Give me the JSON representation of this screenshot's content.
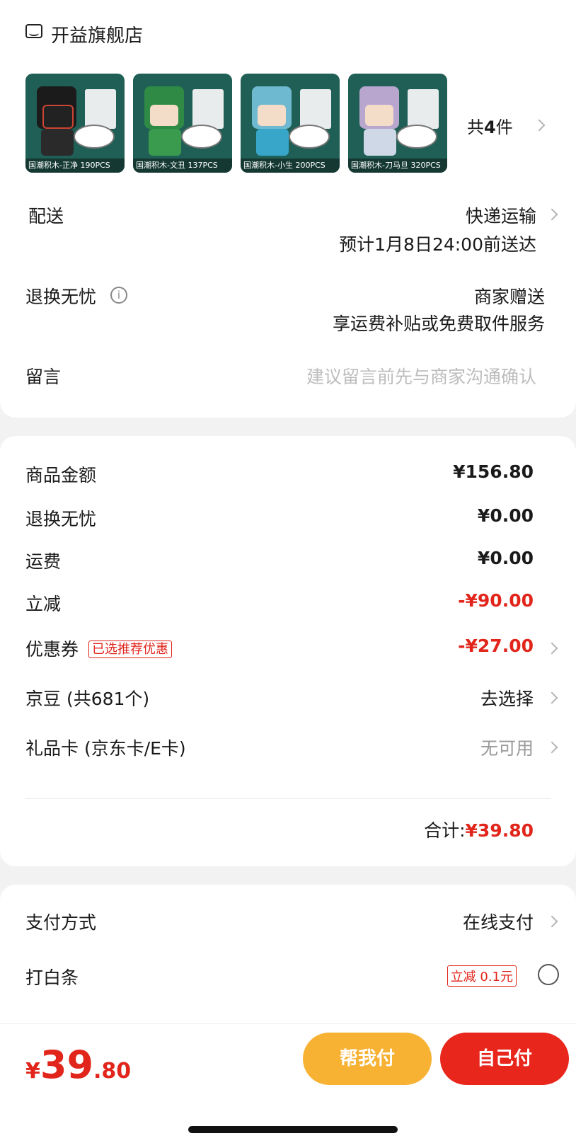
{
  "store": {
    "name": "开益旗舰店",
    "icon": "store-icon"
  },
  "products": [
    {
      "caption": "国潮积木-正净 190PCS",
      "head_color": "#1b1b1b",
      "body_color": "#1e1e1e"
    },
    {
      "caption": "国潮积木-文丑 137PCS",
      "head_color": "#2f8a45",
      "body_color": "#3a9b4f"
    },
    {
      "caption": "国潮积木-小生 200PCS",
      "head_color": "#6fb9d0",
      "body_color": "#37a6c9"
    },
    {
      "caption": "国潮积木-刀马旦 320PCS",
      "head_color": "#b8a6cf",
      "body_color": "#cfd8e6"
    }
  ],
  "product_count": {
    "prefix": "共",
    "num": "4",
    "suffix": "件"
  },
  "delivery": {
    "label": "配送",
    "method": "快递运输",
    "eta": "预计1月8日24:00前送达"
  },
  "return_service": {
    "label": "退换无忧",
    "value": "商家赠送",
    "desc": "享运费补贴或免费取件服务"
  },
  "message": {
    "label": "留言",
    "placeholder": "建议留言前先与商家沟通确认"
  },
  "fees": {
    "goods_amount": {
      "label": "商品金额",
      "value": "¥156.80"
    },
    "return_service": {
      "label": "退换无忧",
      "value": "¥0.00"
    },
    "shipping": {
      "label": "运费",
      "value": "¥0.00"
    },
    "instant_discount": {
      "label": "立减",
      "value": "-¥90.00"
    },
    "coupon": {
      "label": "优惠券",
      "badge": "已选推荐优惠",
      "value": "-¥27.00"
    },
    "jd_beans": {
      "label": "京豆 (共681个)",
      "value": "去选择"
    },
    "gift_card": {
      "label": "礼品卡 (京东卡/E卡)",
      "value": "无可用"
    },
    "total": {
      "label": "合计:",
      "value": "¥39.80"
    }
  },
  "payment": {
    "method": {
      "label": "支付方式",
      "value": "在线支付"
    },
    "baitiao": {
      "label": "打白条",
      "badge": "立减 0.1元"
    }
  },
  "bottom": {
    "price_symbol": "¥",
    "price_int": "39",
    "price_dec": ".80",
    "help_pay": "帮我付",
    "self_pay": "自己付"
  },
  "colors": {
    "accent_red": "#e1251b",
    "help_pay_btn": "#f7b234",
    "self_pay_btn": "#e8261c"
  }
}
